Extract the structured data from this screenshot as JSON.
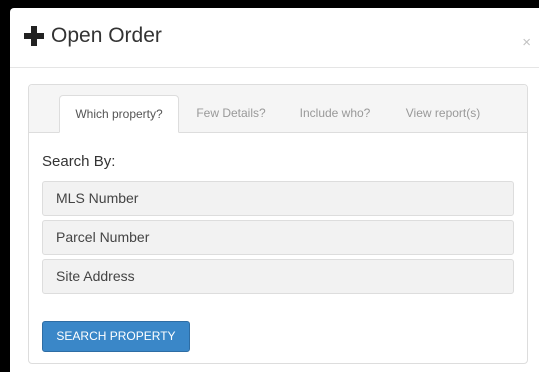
{
  "modal": {
    "title": "Open Order",
    "close_glyph": "×",
    "icons": {
      "title_icon": "plus-icon",
      "close_icon": "close-icon"
    }
  },
  "tabs": [
    {
      "label": "Which property?",
      "active": true
    },
    {
      "label": "Few Details?",
      "active": false
    },
    {
      "label": "Include who?",
      "active": false
    },
    {
      "label": "View report(s)",
      "active": false
    }
  ],
  "search": {
    "heading": "Search By:",
    "options": [
      "MLS Number",
      "Parcel Number",
      "Site Address"
    ],
    "button_label": "SEARCH PROPERTY"
  },
  "colors": {
    "accent": "#3a87c8",
    "backdrop": "#000000",
    "option_bg": "#f2f2f2"
  }
}
